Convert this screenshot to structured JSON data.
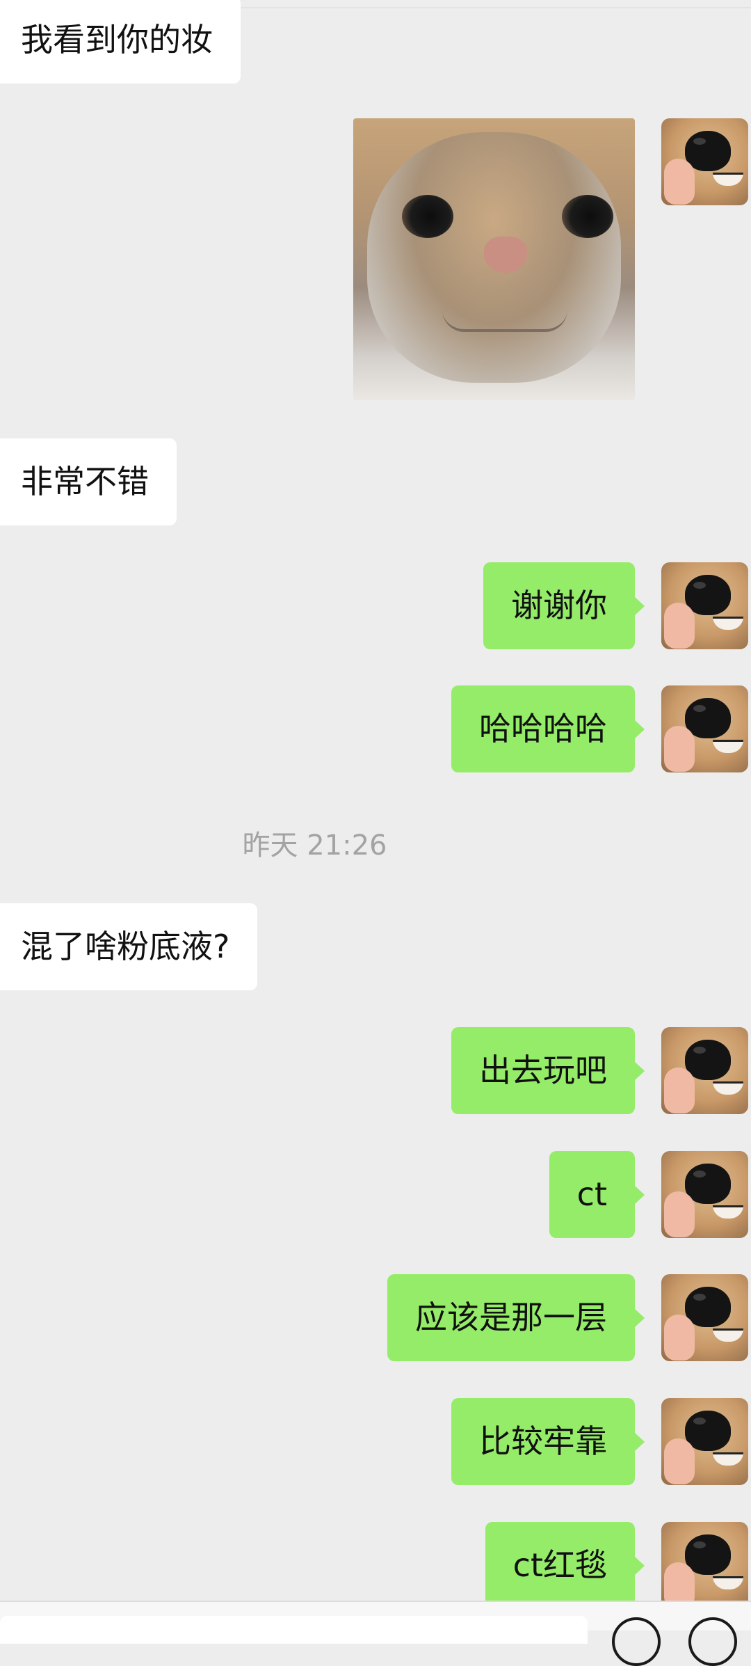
{
  "timestamp": "昨天 21:26",
  "messages": [
    {
      "side": "in",
      "text": "我看到你的妆"
    },
    {
      "side": "out",
      "kind": "image",
      "image": "cat-face-photo"
    },
    {
      "side": "in",
      "text": "非常不错"
    },
    {
      "side": "out",
      "text": "谢谢你"
    },
    {
      "side": "out",
      "text": "哈哈哈哈"
    },
    {
      "side": "in",
      "text": "混了啥粉底液?"
    },
    {
      "side": "out",
      "text": "出去玩吧"
    },
    {
      "side": "out",
      "text": "ct"
    },
    {
      "side": "out",
      "text": "应该是那一层"
    },
    {
      "side": "out",
      "text": "比较牢靠"
    },
    {
      "side": "out",
      "text": "ct红毯"
    }
  ],
  "colors": {
    "background": "#ededed",
    "incoming_bubble": "#ffffff",
    "outgoing_bubble": "#95ec69",
    "timestamp_text": "#a3a3a3"
  },
  "icons": {
    "avatar": "dog-nose-avatar",
    "emoji": "smiley-icon",
    "more": "plus-icon"
  }
}
